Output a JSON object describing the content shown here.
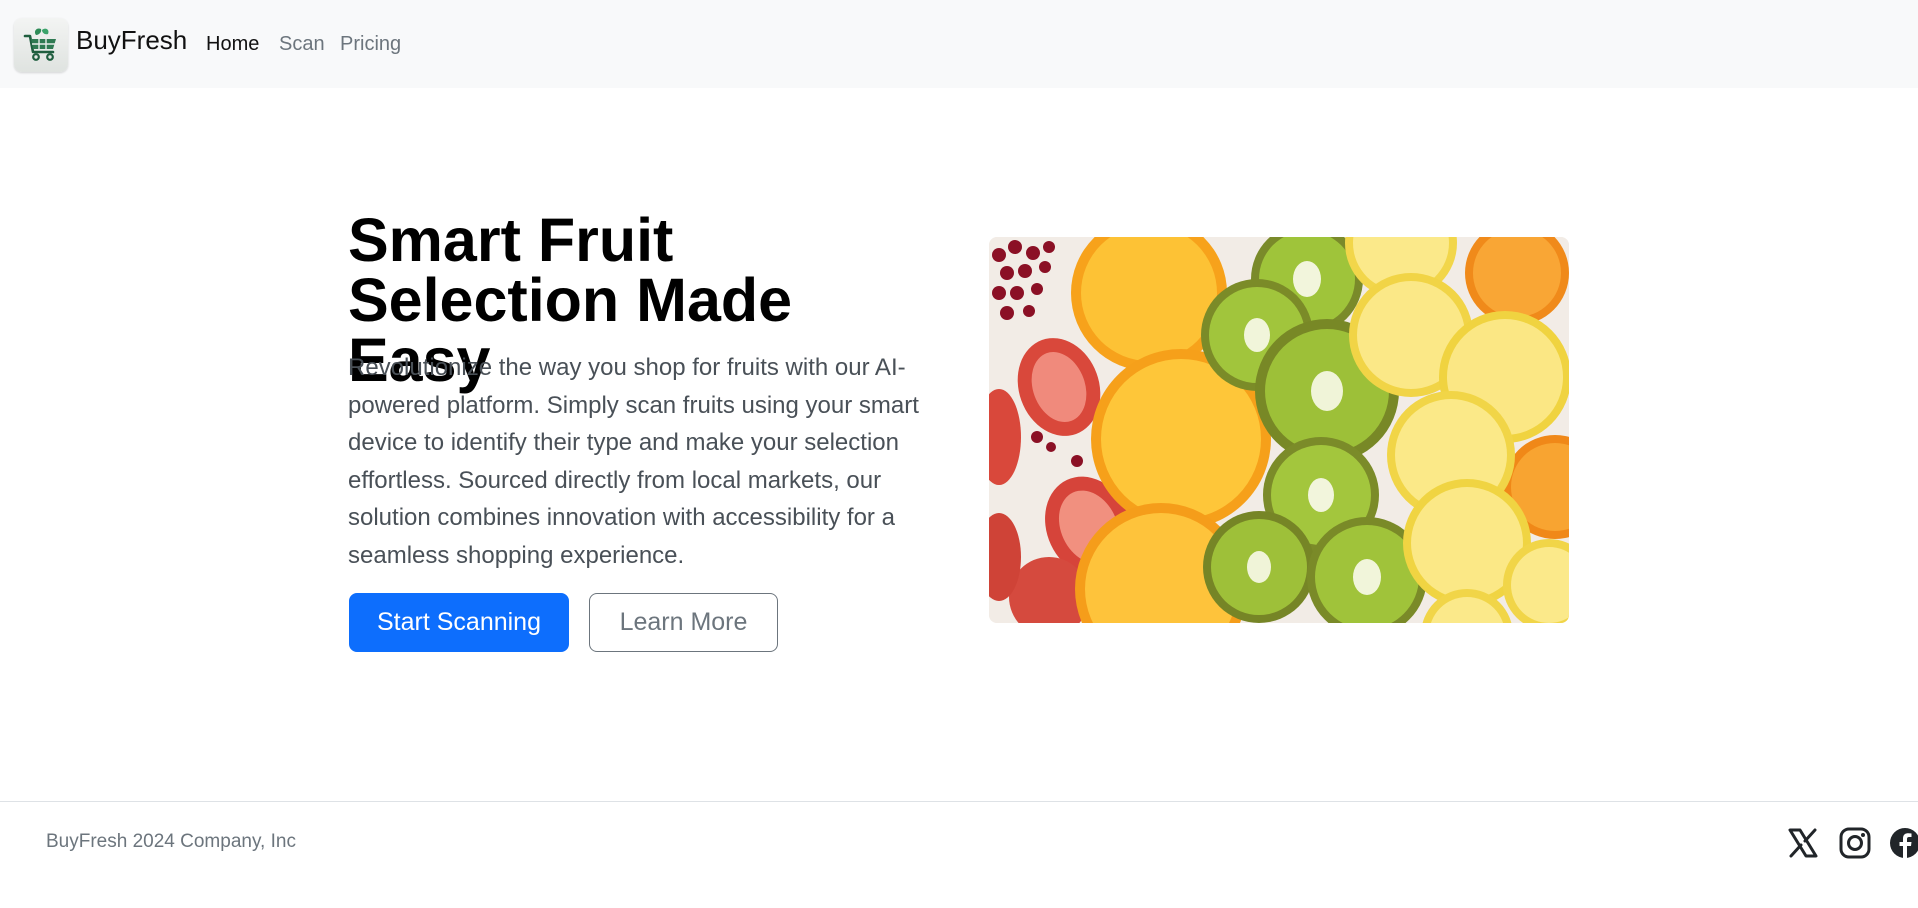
{
  "navbar": {
    "brand": "BuyFresh",
    "logo_icon": "shopping-cart-with-leaf-icon",
    "links": [
      {
        "label": "Home",
        "active": true
      },
      {
        "label": "Scan",
        "active": false
      },
      {
        "label": "Pricing",
        "active": false
      }
    ]
  },
  "hero": {
    "title_line1": "Smart Fruit",
    "title_line2": "Selection Made Easy",
    "description": "Revolutionize the way you shop for fruits with our AI-powered platform. Simply scan fruits using your smart device to identify their type and make your selection effortless. Sourced directly from local markets, our solution combines innovation with accessibility for a seamless shopping experience.",
    "primary_button": "Start Scanning",
    "secondary_button": "Learn More",
    "image_icon": "citrus-kiwi-strawberry-slices-photo"
  },
  "footer": {
    "copyright": "BuyFresh 2024 Company, Inc",
    "social_icons": [
      "x-icon",
      "instagram-icon",
      "facebook-icon"
    ]
  },
  "colors": {
    "primary": "#0d6efd",
    "navbar_bg": "#f8f9fa",
    "muted_text": "#6c757d",
    "body_text": "#495057"
  }
}
